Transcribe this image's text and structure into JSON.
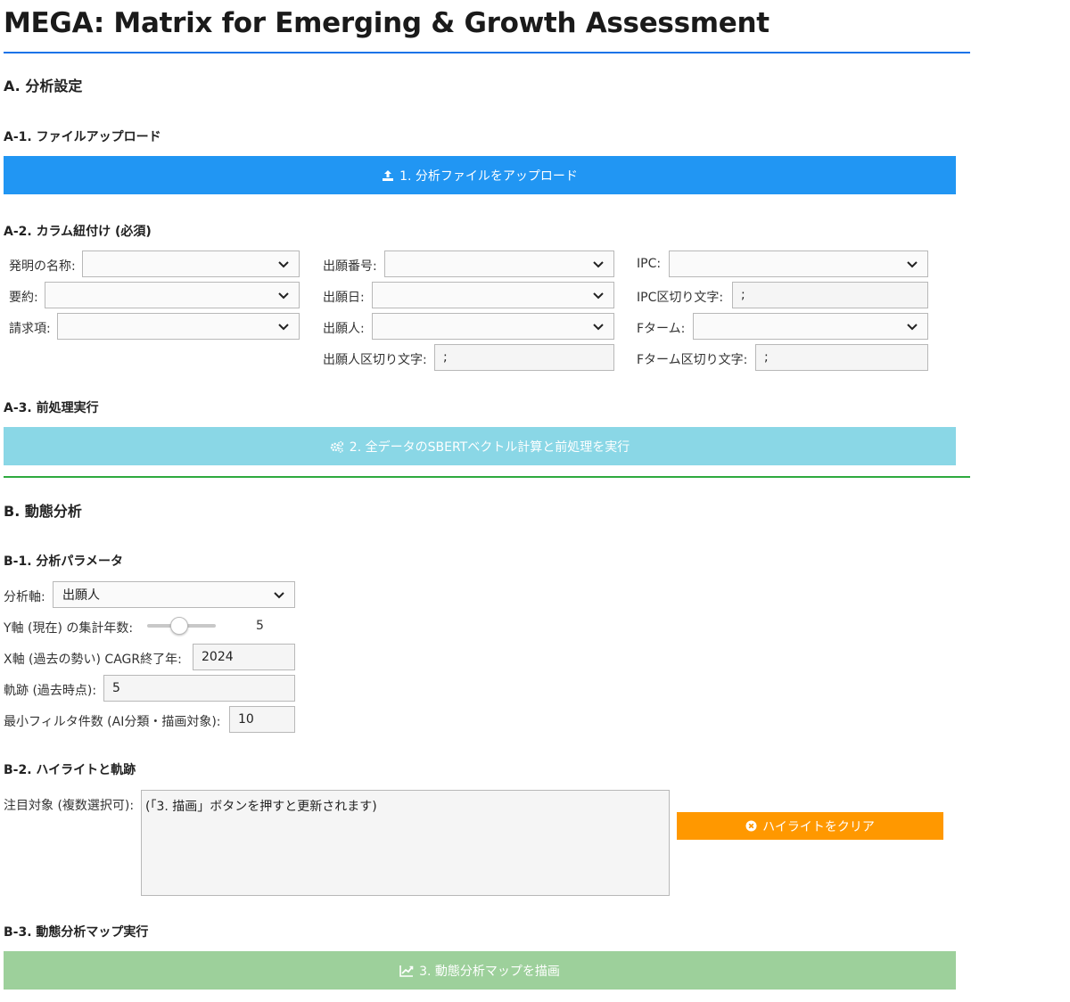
{
  "title": "MEGA: Matrix for Emerging & Growth Assessment",
  "sectionA": {
    "heading": "A. 分析設定",
    "upload": {
      "heading": "A-1. ファイルアップロード",
      "button_label": "1. 分析ファイルをアップロード",
      "button_icon": "upload-icon"
    },
    "columns": {
      "heading": "A-2. カラム紐付け (必須)",
      "invention_name_label": "発明の名称:",
      "abstract_label": "要約:",
      "claims_label": "請求項:",
      "app_number_label": "出願番号:",
      "app_date_label": "出願日:",
      "applicant_label": "出願人:",
      "applicant_delim_label": "出願人区切り文字:",
      "applicant_delim_value": ";",
      "ipc_label": "IPC:",
      "ipc_delim_label": "IPC区切り文字:",
      "ipc_delim_value": ";",
      "fterm_label": "Fターム:",
      "fterm_delim_label": "Fターム区切り文字:",
      "fterm_delim_value": ";"
    },
    "preprocess": {
      "heading": "A-3. 前処理実行",
      "button_label": "2. 全データのSBERTベクトル計算と前処理を実行",
      "button_icon": "gears-icon"
    }
  },
  "sectionB": {
    "heading": "B. 動態分析",
    "params": {
      "heading": "B-1. 分析パラメータ",
      "axis_label": "分析軸:",
      "axis_value": "出願人",
      "years_label": "Y軸 (現在) の集計年数:",
      "years_value": "5",
      "years_fraction": 0.45,
      "cagr_label": "X軸 (過去の勢い) CAGR終了年:",
      "cagr_value": "2024",
      "trail_label": "軌跡 (過去時点):",
      "trail_value": "5",
      "minfilter_label": "最小フィルタ件数 (AI分類・描画対象):",
      "minfilter_value": "10"
    },
    "highlight": {
      "heading": "B-2. ハイライトと軌跡",
      "targets_label": "注目対象 (複数選択可):",
      "targets_placeholder": "(「3. 描画」ボタンを押すと更新されます)",
      "clear_label": "ハイライトをクリア",
      "clear_icon": "times-circle-icon"
    },
    "run": {
      "heading": "B-3. 動態分析マップ実行",
      "button_label": "3. 動態分析マップを描画",
      "button_icon": "chart-line-icon"
    }
  },
  "colors": {
    "primary": "#2196f3",
    "info": "#8ad7e6",
    "success": "#9dd09b",
    "warning": "#ff9800",
    "rule_blue": "#1a73e8",
    "rule_green": "#2eaa3f"
  }
}
